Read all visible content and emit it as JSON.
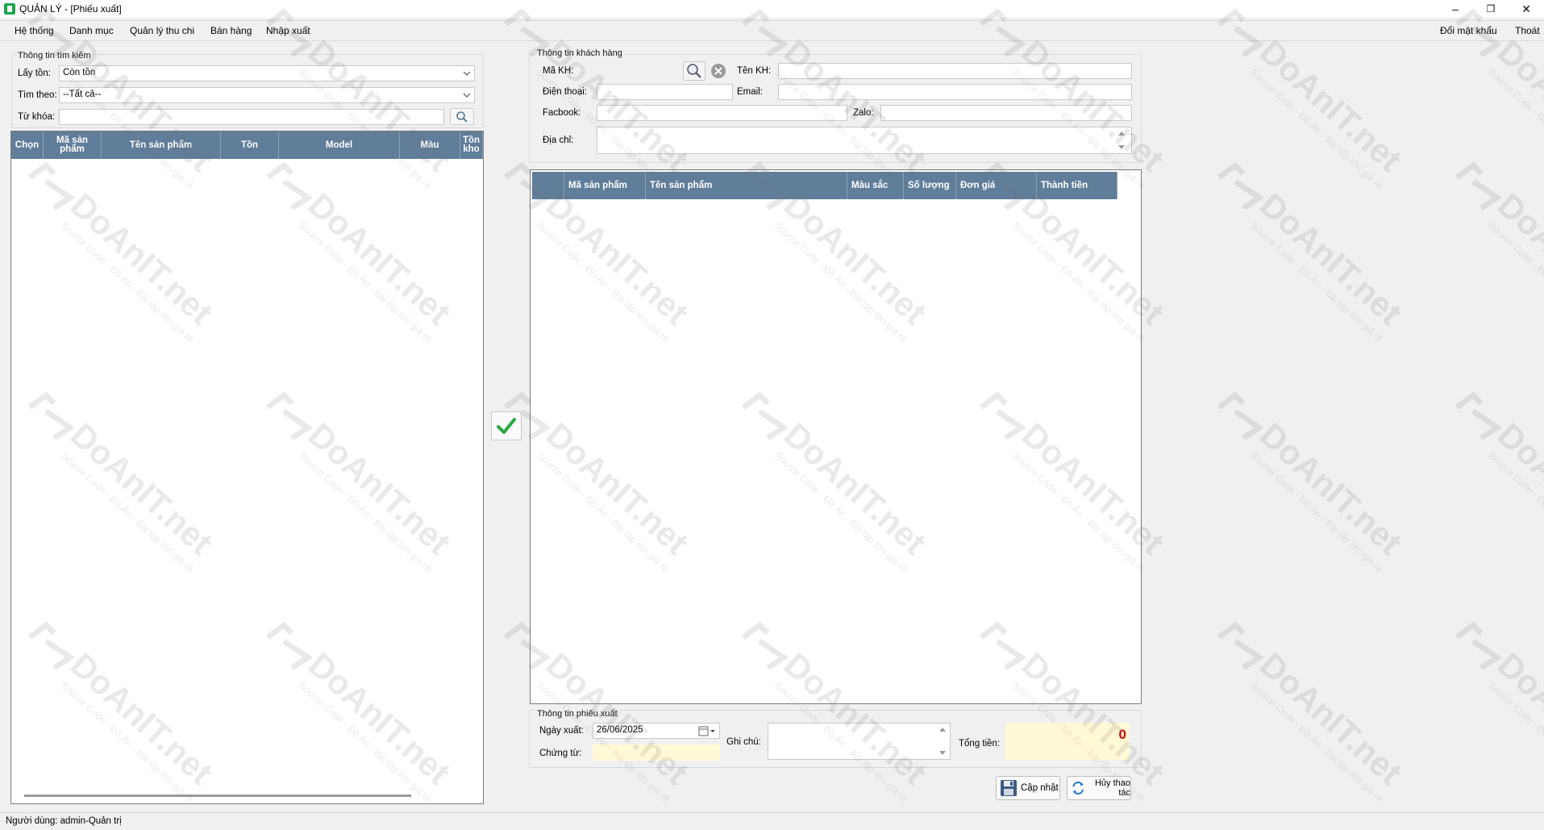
{
  "window": {
    "title": "QUẢN LÝ - [Phiếu xuất]",
    "minimize": "–",
    "restore": "❐",
    "close": "✕"
  },
  "menu": {
    "items": [
      "Hệ thống",
      "Danh mục",
      "Quản lý thu chi",
      "Bán hàng",
      "Nhập xuất"
    ],
    "right_items": [
      "Đổi mật khẩu",
      "Thoát"
    ]
  },
  "search": {
    "group_title": "Thông tin tìm kiếm",
    "stock_label": "Lấy tồn:",
    "stock_value": "Còn tồn",
    "find_by_label": "Tìm theo:",
    "find_by_value": "--Tất cả--",
    "keyword_label": "Từ khóa:",
    "keyword_value": ""
  },
  "product_grid": {
    "columns": [
      "Chọn",
      "Mã sản phẩm",
      "Tên sản phẩm",
      "Tồn",
      "Model",
      "Màu",
      "Tồn kho"
    ],
    "rows": []
  },
  "customer": {
    "group_title": "Thông tin khách hàng",
    "code_label": "Mã KH:",
    "code_value": "",
    "name_label": "Tên KH:",
    "name_value": "",
    "phone_label": "Điện thoại:",
    "phone_value": "",
    "email_label": "Email:",
    "email_value": "",
    "facebook_label": "Facbook:",
    "facebook_value": "",
    "zalo_label": "Zalo:",
    "zalo_value": "",
    "address_label": "Địa chỉ:",
    "address_value": ""
  },
  "order_grid": {
    "columns": [
      "",
      "Mã sản phẩm",
      "Tên sản phẩm",
      "Màu sắc",
      "Số lượng",
      "Đơn giá",
      "Thành tiền"
    ],
    "rows": []
  },
  "receipt": {
    "group_title": "Thông tin phiếu xuất",
    "date_label": "Ngày xuất:",
    "date_value": "26/06/2025",
    "voucher_label": "Chứng từ:",
    "voucher_value": "",
    "note_label": "Ghi chú:",
    "note_value": "",
    "total_label": "Tổng tiền:",
    "total_value": "0"
  },
  "actions": {
    "update_label": "Cập nhật",
    "cancel_label": "Hủy thao tác"
  },
  "status": {
    "user_text": "Người dùng: admin-Quản trị"
  },
  "watermark": {
    "brand": "DoAnIT.net",
    "tagline": "Source Code - Đồ Án - Bài tập lớn giá rẻ"
  },
  "colors": {
    "grid_header": "#607d99",
    "accent_green": "#27a844",
    "total_red": "#d40000",
    "yellow_field": "#fff9d6"
  }
}
